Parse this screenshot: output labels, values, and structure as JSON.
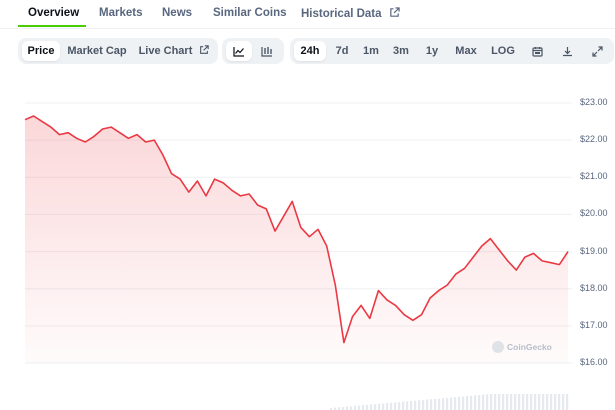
{
  "tabs": [
    "Overview",
    "Markets",
    "News",
    "Similar Coins",
    "Historical Data"
  ],
  "active_tab": "Overview",
  "chart_type_buttons": [
    "Price",
    "Market Cap",
    "Live Chart"
  ],
  "active_chart_type": "Price",
  "range_buttons": [
    "24h",
    "7d",
    "1m",
    "3m",
    "1y",
    "Max",
    "LOG"
  ],
  "active_range": "24h",
  "icons": [
    "line-chart-icon",
    "candlestick-icon",
    "calendar-icon",
    "download-icon",
    "expand-icon",
    "external-link-icon"
  ],
  "watermark": "CoinGecko",
  "colors": {
    "line": "#ea3943",
    "accent": "#4bcc00",
    "grid": "#eef0f3"
  },
  "chart_data": {
    "type": "area",
    "ylim": [
      16.0,
      23.0
    ],
    "yticks": [
      "$16.00",
      "$17.00",
      "$18.00",
      "$19.00",
      "$20.00",
      "$21.00",
      "$22.00",
      "$23.00"
    ],
    "series": [
      {
        "values": [
          22.55,
          22.65,
          22.5,
          22.35,
          22.15,
          22.2,
          22.05,
          21.95,
          22.1,
          22.3,
          22.35,
          22.2,
          22.05,
          22.15,
          21.95,
          22.0,
          21.6,
          21.1,
          20.95,
          20.6,
          20.9,
          20.5,
          20.95,
          20.85,
          20.65,
          20.5,
          20.55,
          20.25,
          20.15,
          19.55,
          19.95,
          20.35,
          19.65,
          19.4,
          19.6,
          19.15,
          18.1,
          16.55,
          17.25,
          17.55,
          17.2,
          17.95,
          17.7,
          17.55,
          17.3,
          17.15,
          17.3,
          17.75,
          17.95,
          18.1,
          18.4,
          18.55,
          18.85,
          19.15,
          19.35,
          19.05,
          18.75,
          18.5,
          18.85,
          18.95,
          18.75,
          18.7,
          18.65,
          19.0
        ]
      }
    ]
  }
}
